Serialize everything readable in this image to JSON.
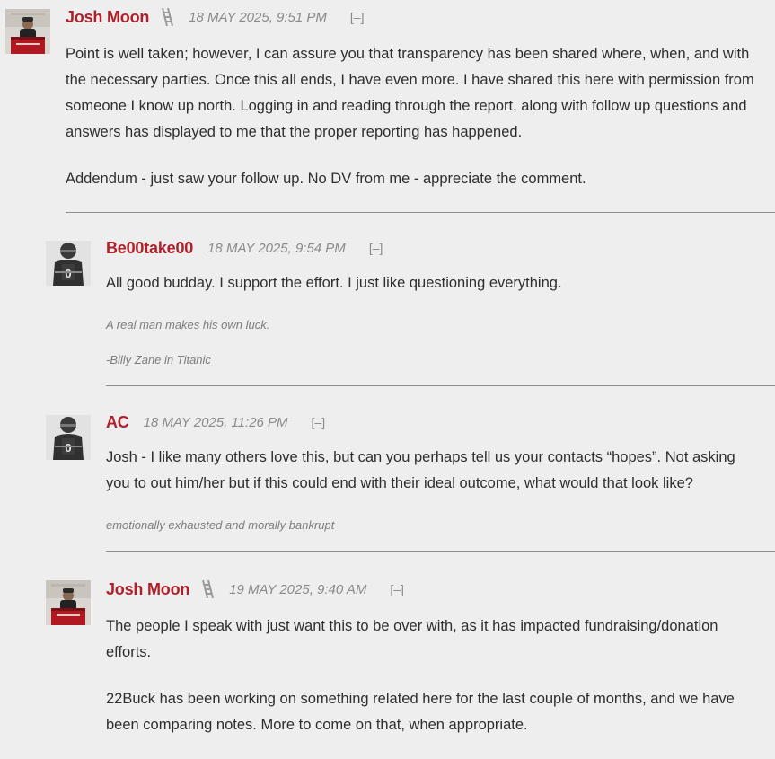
{
  "comments": [
    {
      "author": "Josh Moon",
      "badge_icon": "ladder-badge-icon",
      "avatar_icon": "user-avatar-podium-icon",
      "timestamp": "18 MAY 2025, 9:51 PM",
      "collapse": "[–]",
      "paragraphs": [
        "Point is well taken; however, I can assure you that transparency has been shared where, when, and with the necessary parties.  Once this all ends, I have even more.  I have shared this here with permission from someone I know up north.  Logging in and reading through the report, along with follow up questions and answers has displayed to me that the proper reporting has happened.",
        "Addendum - just saw your follow up.  No DV from me - appreciate the comment."
      ]
    },
    {
      "author": "Be00take00",
      "avatar_icon": "user-avatar-football-icon",
      "timestamp": "18 MAY 2025, 9:54 PM",
      "collapse": "[–]",
      "paragraphs": [
        "All good budday. I support the effort. I just like questioning everything."
      ],
      "signature": [
        "A real man makes his own luck.",
        "-Billy Zane in Titanic"
      ]
    },
    {
      "author": "AC",
      "avatar_icon": "user-avatar-football-icon",
      "timestamp": "18 MAY 2025, 11:26 PM",
      "collapse": "[–]",
      "paragraphs": [
        "Josh - I like many others love this, but can you perhaps tell us your contacts “hopes”. Not asking you to out him/her but if this could end with their ideal outcome, what would that look like?"
      ],
      "signature": [
        "emotionally exhausted and morally bankrupt"
      ]
    },
    {
      "author": "Josh Moon",
      "badge_icon": "ladder-badge-icon",
      "avatar_icon": "user-avatar-podium-icon",
      "timestamp": "19 MAY 2025, 9:40 AM",
      "collapse": "[–]",
      "paragraphs": [
        "The people I speak with just want this to be over with, as it has impacted fundraising/donation efforts.",
        "22Buck has been working on something related here for the last couple of months, and we have been comparing notes.  More to come on that, when appropriate."
      ]
    }
  ],
  "colors": {
    "author": "#b0202a",
    "background": "#eeeeee",
    "timestamp": "#8a8a8a",
    "rule": "#8e8e8e"
  }
}
